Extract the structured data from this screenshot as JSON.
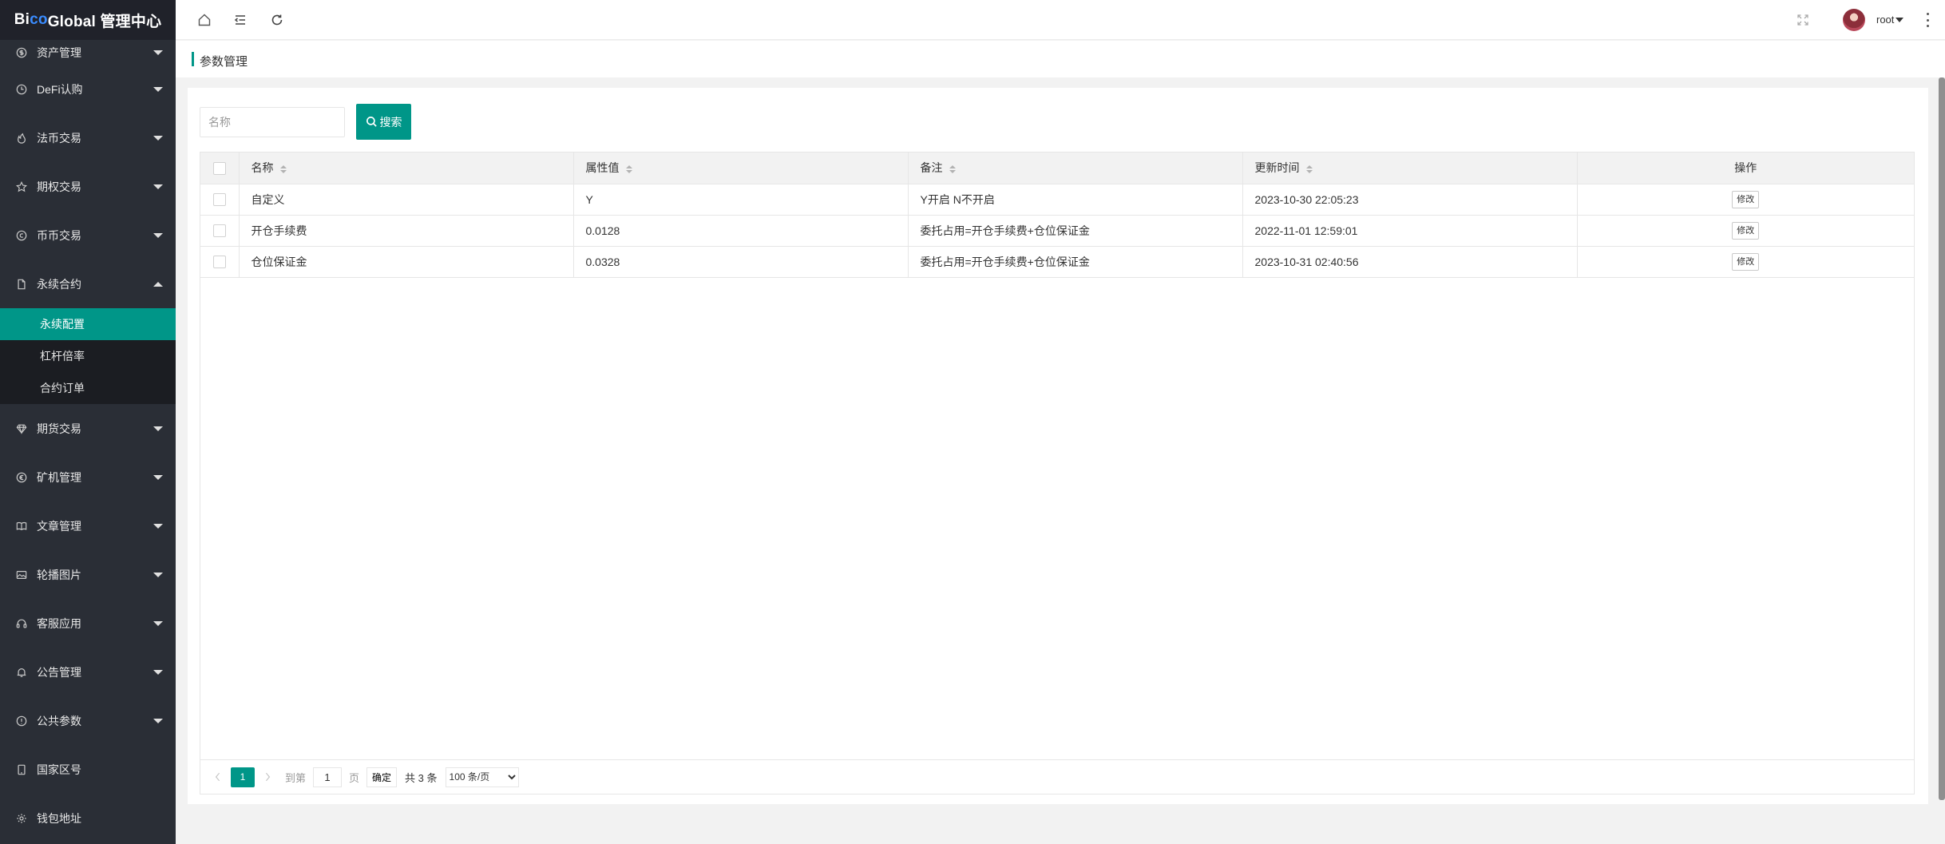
{
  "app": {
    "logo_parts": [
      "Bi",
      "co",
      " Global 管理中心"
    ]
  },
  "sidebar": {
    "items": [
      {
        "label": "资产管理",
        "icon": "dollar-circle-icon"
      },
      {
        "label": "DeFi认购",
        "icon": "clock-icon"
      },
      {
        "label": "法币交易",
        "icon": "fire-icon"
      },
      {
        "label": "期权交易",
        "icon": "star-icon"
      },
      {
        "label": "币币交易",
        "icon": "coin-icon"
      },
      {
        "label": "永续合约",
        "icon": "file-icon",
        "expanded": true
      },
      {
        "label": "期货交易",
        "icon": "diamond-icon"
      },
      {
        "label": "矿机管理",
        "icon": "euro-icon"
      },
      {
        "label": "文章管理",
        "icon": "book-icon"
      },
      {
        "label": "轮播图片",
        "icon": "image-icon"
      },
      {
        "label": "客服应用",
        "icon": "headset-icon"
      },
      {
        "label": "公告管理",
        "icon": "bell-icon"
      },
      {
        "label": "公共参数",
        "icon": "info-icon"
      },
      {
        "label": "国家区号",
        "icon": "phone-icon"
      },
      {
        "label": "钱包地址",
        "icon": "settings-icon"
      }
    ],
    "sub_items": [
      {
        "label": "永续配置",
        "active": true
      },
      {
        "label": "杠杆倍率",
        "active": false
      },
      {
        "label": "合约订单",
        "active": false
      }
    ]
  },
  "header": {
    "user": "root"
  },
  "breadcrumb": {
    "title": "参数管理"
  },
  "search": {
    "placeholder": "名称",
    "button_label": "搜索"
  },
  "table": {
    "columns": [
      "名称",
      "属性值",
      "备注",
      "更新时间",
      "操作"
    ],
    "rows": [
      {
        "name": "自定义",
        "value": "Y",
        "remark": "Y开启 N不开启",
        "updated": "2023-10-30 22:05:23",
        "action": "修改"
      },
      {
        "name": "开仓手续费",
        "value": "0.0128",
        "remark": "委托占用=开仓手续费+仓位保证金",
        "updated": "2022-11-01 12:59:01",
        "action": "修改"
      },
      {
        "name": "仓位保证金",
        "value": "0.0328",
        "remark": "委托占用=开仓手续费+仓位保证金",
        "updated": "2023-10-31 02:40:56",
        "action": "修改"
      }
    ]
  },
  "pagination": {
    "current_page": "1",
    "goto_label": "到第",
    "goto_value": "1",
    "page_unit": "页",
    "confirm_label": "确定",
    "total_label": "共 3 条",
    "page_size": "100 条/页"
  },
  "colors": {
    "accent": "#009688",
    "sidebar_bg": "#2a2e36",
    "logo_bg": "#20222a"
  }
}
